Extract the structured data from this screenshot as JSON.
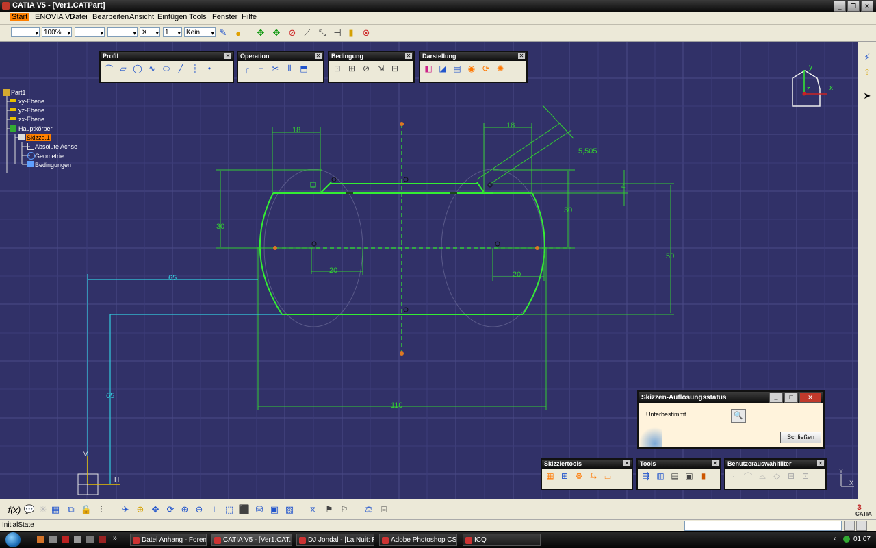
{
  "window": {
    "title": "CATIA V5 - [Ver1.CATPart]"
  },
  "menu": [
    "Start",
    "ENOVIA V5",
    "Datei",
    "Bearbeiten",
    "Ansicht",
    "Einfügen",
    "Tools",
    "Fenster",
    "Hilfe"
  ],
  "toolbar": {
    "zoom": "100%",
    "layer": "Kein",
    "thickness_num": "1"
  },
  "panels": {
    "profil": "Profil",
    "operation": "Operation",
    "bedingung": "Bedingung",
    "darstellung": "Darstellung",
    "skizziertools": "Skizziertools",
    "tools": "Tools",
    "benutzerauswahlfilter": "Benutzerauswahlfilter"
  },
  "tree": {
    "root": "Part1",
    "xy": "xy-Ebene",
    "yz": "yz-Ebene",
    "zx": "zx-Ebene",
    "body": "Hauptkörper",
    "sketch": "Skizze.1",
    "axis": "Absolute Achse",
    "geometry": "Geometrie",
    "constraints": "Bedingungen"
  },
  "compass": {
    "x": "x",
    "y": "y",
    "z": "z"
  },
  "sketch_axes": {
    "h": "H",
    "v": "V"
  },
  "dimensions": {
    "d18_left": "18",
    "d18_right": "18",
    "d5505": "5,505",
    "d4": "4",
    "d30_left": "30",
    "d30_right": "30",
    "d50": "50",
    "d20_left": "20",
    "d20_right": "20",
    "d65_h": "65",
    "d65_v": "65",
    "d110": "110"
  },
  "dialog": {
    "title": "Skizzen-Auflösungsstatus",
    "status": "Unterbestimmt",
    "close_button": "Schließen"
  },
  "corner_axis": {
    "y": "Y",
    "x": "X"
  },
  "brand": "CATIA",
  "status": {
    "text": "InitialState"
  },
  "taskbar": {
    "tasks": [
      "Datei Anhang - Foren ...",
      "CATIA V5 - [Ver1.CAT...",
      "DJ Jondal - [La Nuit: R...",
      "Adobe Photoshop CS3...",
      "ICQ"
    ],
    "more": "»",
    "clock": "01:07"
  },
  "colors": {
    "workspace": "#313168",
    "sketch_green": "#33ee33",
    "dimension_green": "#33cc33",
    "highlight_cyan": "#33ccdd",
    "point_orange": "#dd7722",
    "selection_orange": "#ff8000"
  }
}
